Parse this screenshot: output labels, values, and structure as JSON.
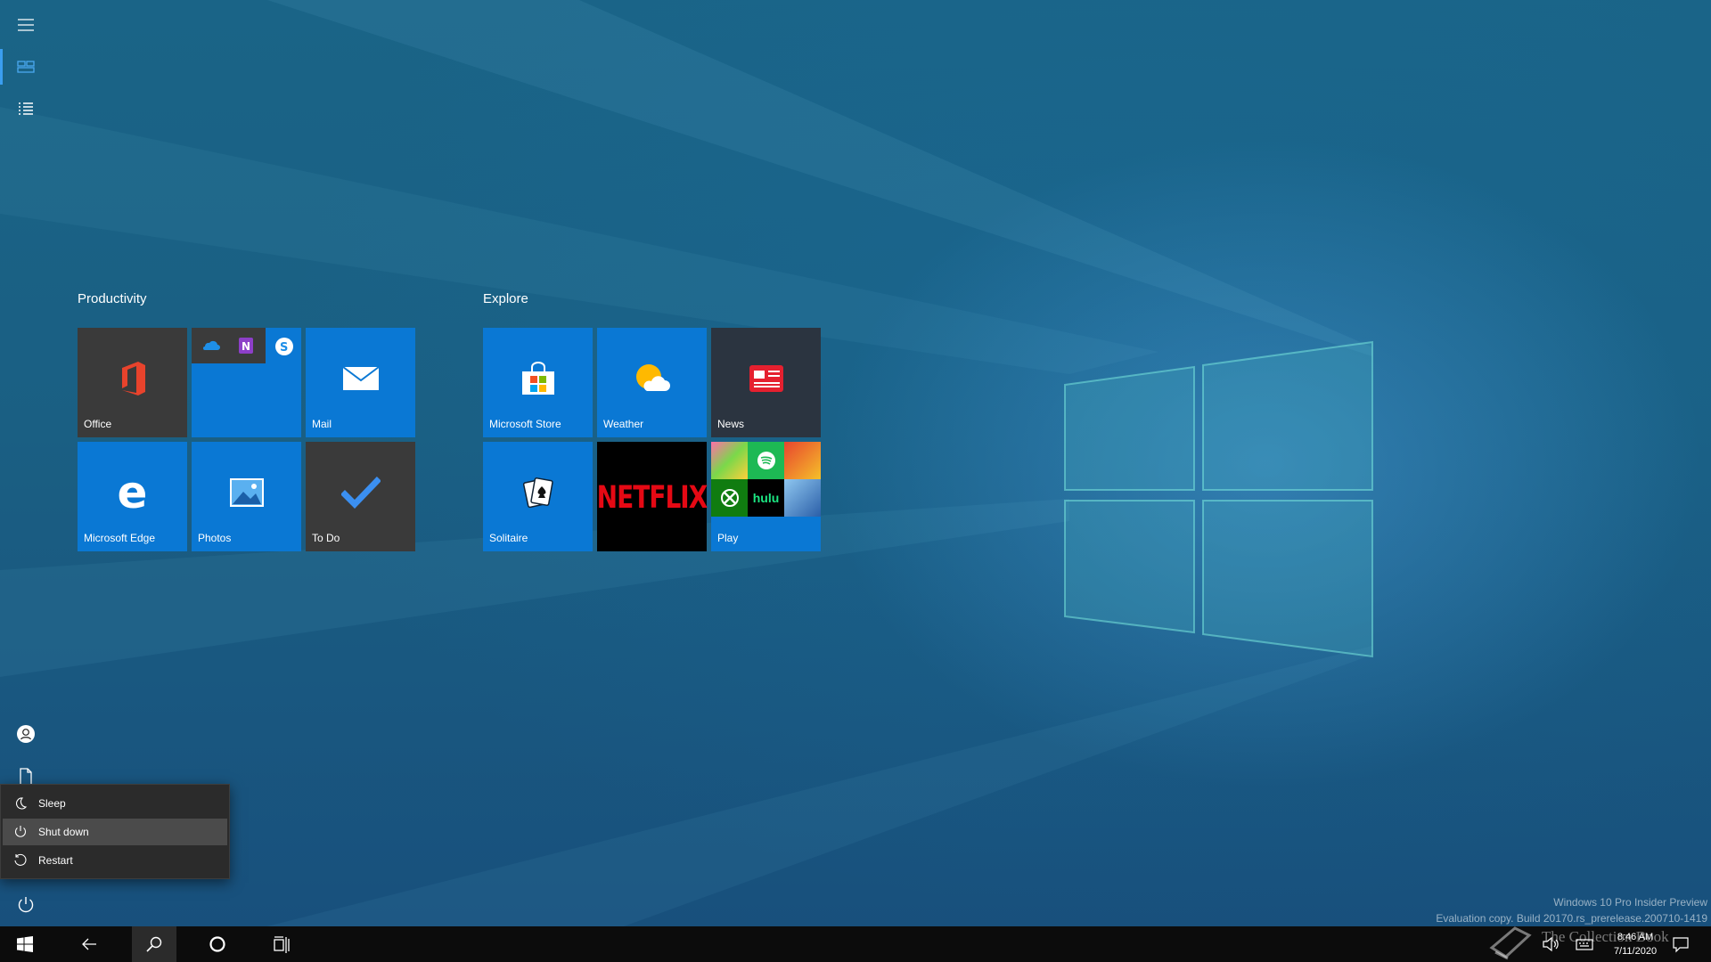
{
  "groups": {
    "productivity": {
      "title": "Productivity",
      "tiles": {
        "office": "Office",
        "mail": "Mail",
        "edge": "Microsoft Edge",
        "photos": "Photos",
        "todo": "To Do"
      }
    },
    "explore": {
      "title": "Explore",
      "tiles": {
        "store": "Microsoft Store",
        "weather": "Weather",
        "news": "News",
        "solitaire": "Solitaire",
        "netflix": "NETFLIX",
        "play": "Play"
      }
    }
  },
  "play_tile": {
    "hulu": "hulu"
  },
  "power_menu": {
    "items": [
      "Sleep",
      "Shut down",
      "Restart"
    ]
  },
  "watermark": {
    "line1": "Windows 10 Pro Insider Preview",
    "line2": "Evaluation copy. Build 20170.rs_prerelease.200710-1419"
  },
  "clock": {
    "time": "8:46 AM",
    "date": "7/11/2020"
  },
  "brand": "The Collection Book",
  "colors": {
    "tile_blue": "#0a78d4",
    "accent": "#3b9ef0",
    "taskbar": "#0c0c0c"
  },
  "icons": [
    "hamburger-icon",
    "tiles-icon",
    "all-apps-icon",
    "user-icon",
    "document-icon",
    "power-icon",
    "windows-logo-icon",
    "back-arrow-icon",
    "search-icon",
    "cortana-icon",
    "task-view-icon",
    "volume-icon",
    "keyboard-icon",
    "notification-icon"
  ]
}
